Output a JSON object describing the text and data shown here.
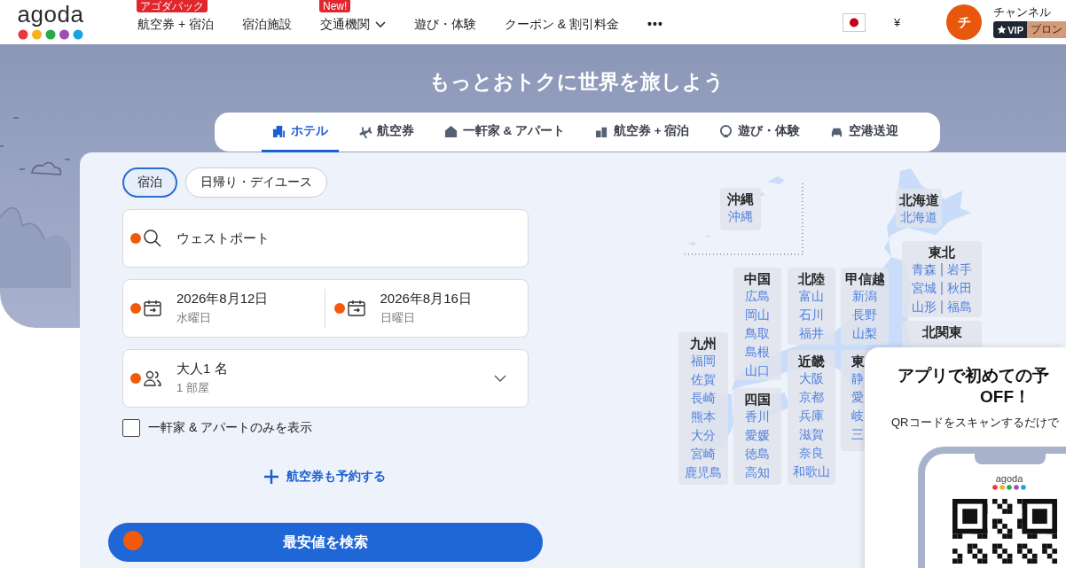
{
  "header": {
    "logo": "agoda",
    "nav": [
      {
        "label": "航空券 + 宿泊",
        "badge": "アゴダパック",
        "dropdown": false
      },
      {
        "label": "宿泊施設",
        "dropdown": false
      },
      {
        "label": "交通機関",
        "badge": "New!",
        "dropdown": true
      },
      {
        "label": "遊び・体験",
        "dropdown": false
      },
      {
        "label": "クーポン & 割引料金",
        "dropdown": false
      }
    ],
    "more": "•••",
    "currency": "¥",
    "user": {
      "initial": "チ",
      "name": "チャンネル",
      "vip": "VIP",
      "tier": "ブロン"
    }
  },
  "hero": {
    "title": "もっとおトクに世界を旅しよう",
    "tabs": [
      {
        "label": "ホテル",
        "selected": true
      },
      {
        "label": "航空券",
        "selected": false
      },
      {
        "label": "一軒家 & アパート",
        "selected": false
      },
      {
        "label": "航空券 + 宿泊",
        "selected": false
      },
      {
        "label": "遊び・体験",
        "selected": false
      },
      {
        "label": "空港送迎",
        "selected": false
      }
    ]
  },
  "search": {
    "stay_types": [
      {
        "label": "宿泊",
        "selected": true
      },
      {
        "label": "日帰り・デイユース",
        "selected": false
      }
    ],
    "destination": {
      "value": "ウェストポート"
    },
    "checkin": {
      "date": "2026年8月12日",
      "weekday": "水曜日"
    },
    "checkout": {
      "date": "2026年8月16日",
      "weekday": "日曜日"
    },
    "guests": {
      "value": "大人1 名",
      "rooms": "1 部屋"
    },
    "homes_only": {
      "label": "一軒家 & アパートのみを表示",
      "checked": false
    },
    "add_flight": "航空券も予約する",
    "submit": "最安値を検索"
  },
  "map": {
    "regions": [
      {
        "name": "沖縄",
        "kind": "list",
        "prefectures": [
          "沖縄"
        ]
      },
      {
        "name": "北海道",
        "kind": "list",
        "prefectures": [
          "北海道"
        ]
      },
      {
        "name": "東北",
        "kind": "pairs",
        "prefectures": [
          "青森",
          "岩手",
          "宮城",
          "秋田",
          "山形",
          "福島"
        ]
      },
      {
        "name": "中国",
        "kind": "list",
        "prefectures": [
          "広島",
          "岡山",
          "鳥取",
          "島根",
          "山口"
        ]
      },
      {
        "name": "北陸",
        "kind": "list",
        "prefectures": [
          "富山",
          "石川",
          "福井"
        ]
      },
      {
        "name": "甲信越",
        "kind": "list",
        "prefectures": [
          "新潟",
          "長野",
          "山梨"
        ]
      },
      {
        "name": "北関東"
      },
      {
        "name": "九州",
        "kind": "list",
        "prefectures": [
          "福岡",
          "佐賀",
          "長崎",
          "熊本",
          "大分",
          "宮崎",
          "鹿児島"
        ]
      },
      {
        "name": "四国",
        "kind": "list",
        "prefectures": [
          "香川",
          "愛媛",
          "徳島",
          "高知"
        ]
      },
      {
        "name": "近畿",
        "kind": "list",
        "prefectures": [
          "大阪",
          "京都",
          "兵庫",
          "滋賀",
          "奈良",
          "和歌山"
        ]
      },
      {
        "name": "東",
        "kind": "list",
        "prefectures": [
          "静",
          "愛",
          "岐",
          "三"
        ]
      }
    ]
  },
  "app_promo": {
    "title": "アプリで初めての予",
    "title_2": "OFF！",
    "text": "QRコードをスキャンするだけで",
    "phone_logo": "agoda"
  }
}
